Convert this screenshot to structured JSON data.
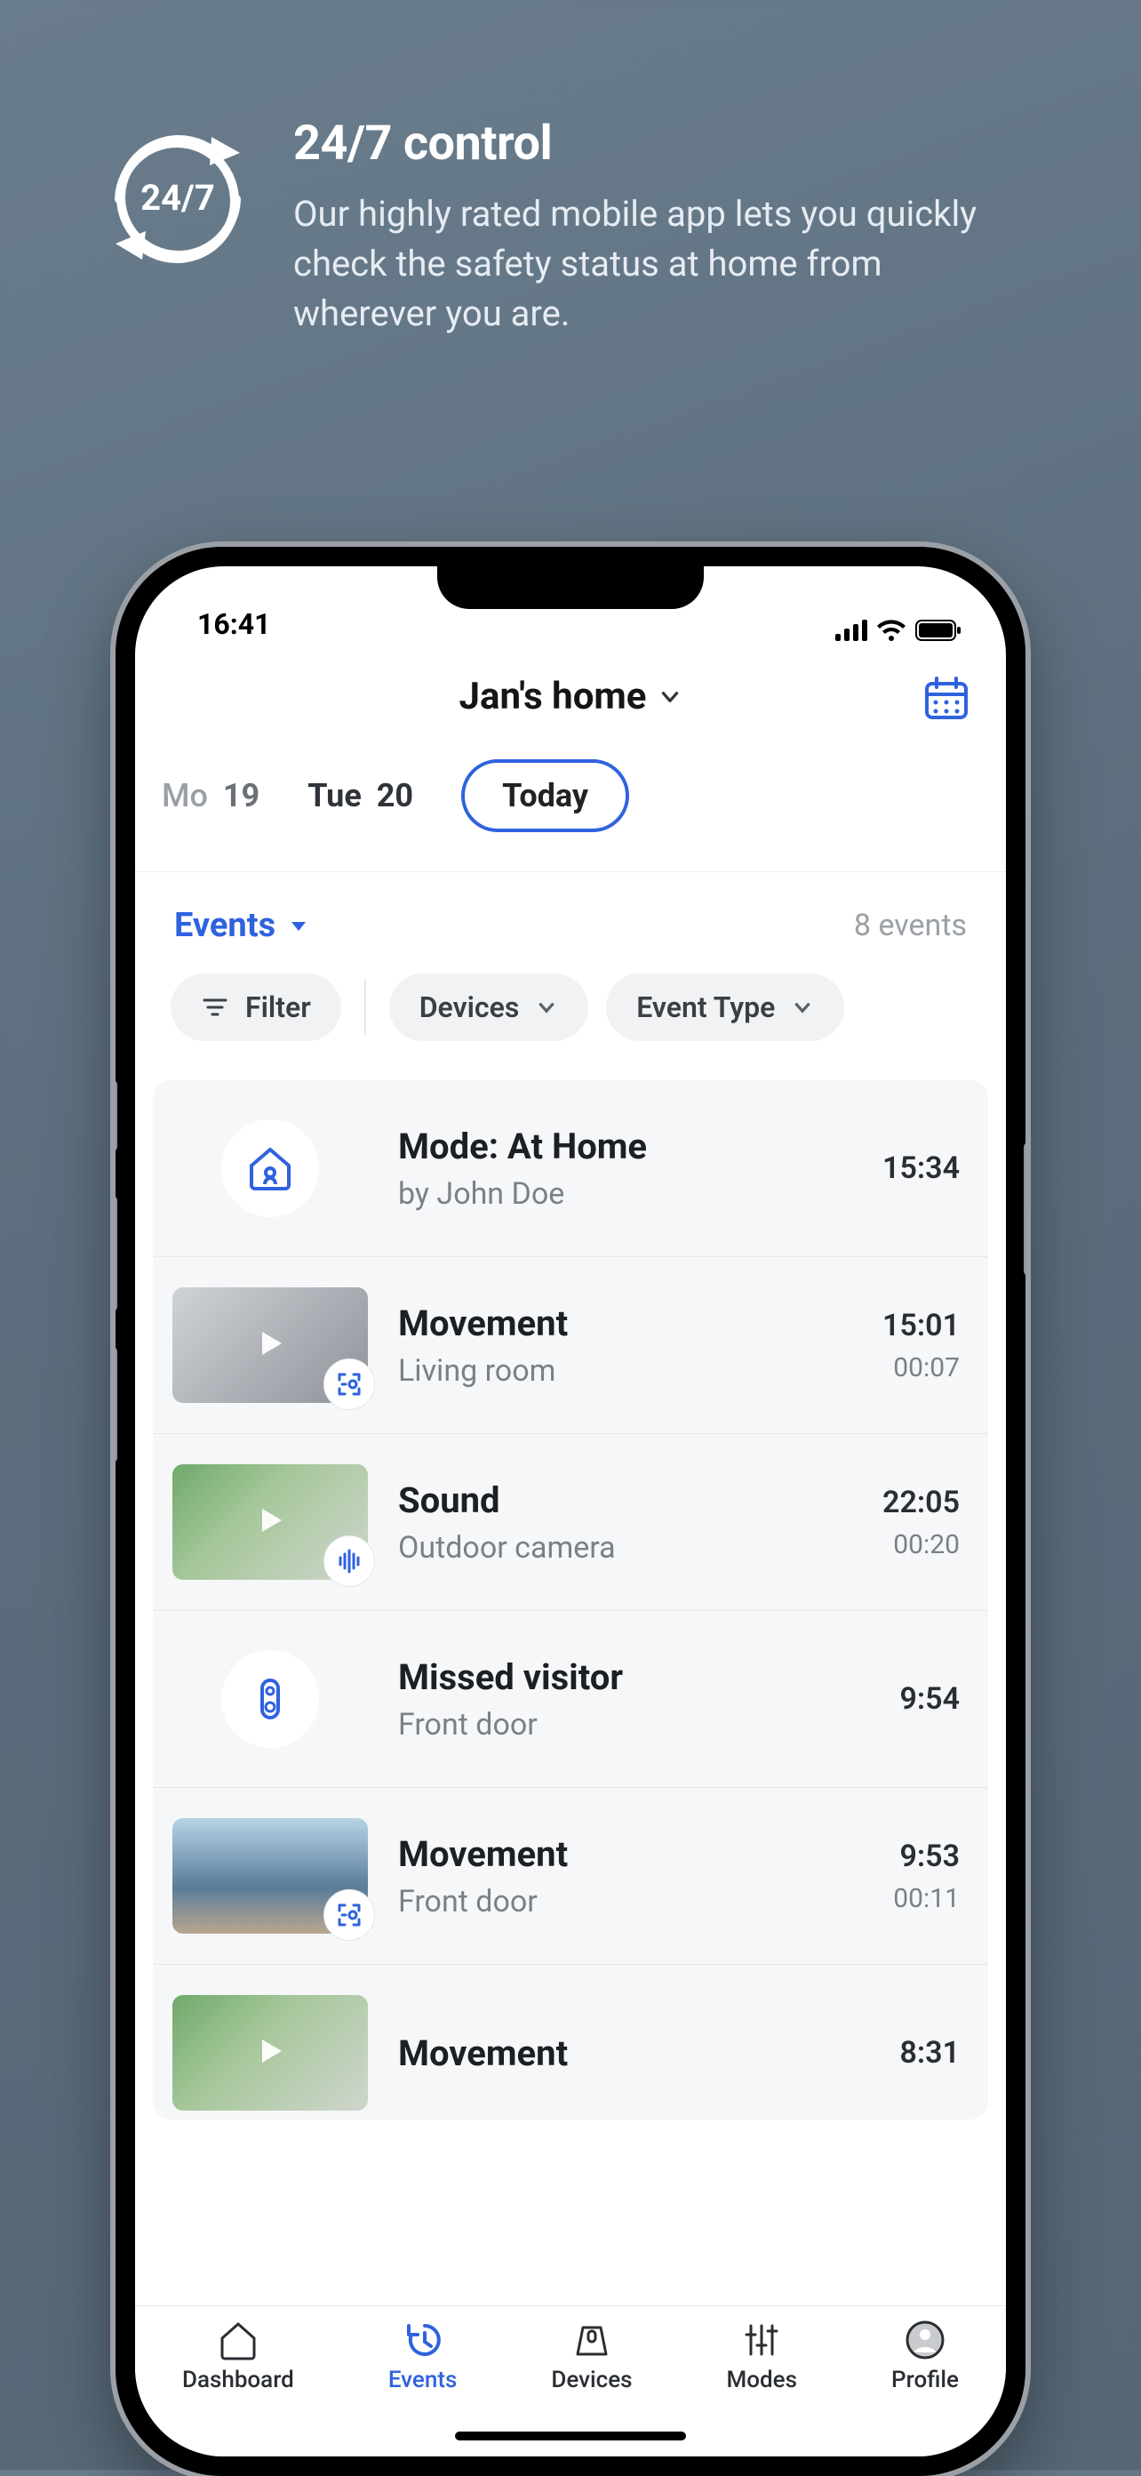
{
  "promo": {
    "icon_text": "24/7",
    "title": "24/7 control",
    "body": "Our highly rated mobile app lets you quickly check the safety status at home from wherever you are."
  },
  "statusbar": {
    "time": "16:41"
  },
  "header": {
    "title": "Jan's home"
  },
  "dates": {
    "prev2": {
      "dow": "Mo",
      "num": "19"
    },
    "prev1": {
      "dow": "Tue",
      "num": "20"
    },
    "today_label": "Today"
  },
  "events_head": {
    "dropdown": "Events",
    "count": "8 events"
  },
  "filters": {
    "filter": "Filter",
    "devices": "Devices",
    "eventtype": "Event Type"
  },
  "events": [
    {
      "title": "Mode: At Home",
      "subtitle": "by John Doe",
      "t1": "15:34",
      "t2": ""
    },
    {
      "title": "Movement",
      "subtitle": "Living room",
      "t1": "15:01",
      "t2": "00:07"
    },
    {
      "title": "Sound",
      "subtitle": "Outdoor camera",
      "t1": "22:05",
      "t2": "00:20"
    },
    {
      "title": "Missed visitor",
      "subtitle": "Front door",
      "t1": "9:54",
      "t2": ""
    },
    {
      "title": "Movement",
      "subtitle": "Front door",
      "t1": "9:53",
      "t2": "00:11"
    },
    {
      "title": "Movement",
      "subtitle": "",
      "t1": "8:31",
      "t2": ""
    }
  ],
  "tabs": {
    "dashboard": "Dashboard",
    "events": "Events",
    "devices": "Devices",
    "modes": "Modes",
    "profile": "Profile"
  },
  "colors": {
    "accent": "#2f62de"
  }
}
